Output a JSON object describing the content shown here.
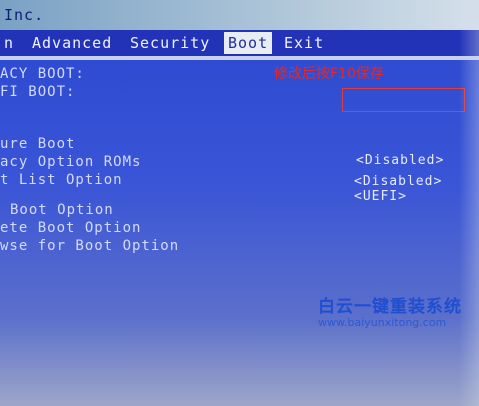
{
  "header": {
    "vendor": "Inc."
  },
  "menu": {
    "tabs": [
      {
        "label": "n"
      },
      {
        "label": "Advanced"
      },
      {
        "label": "Security"
      },
      {
        "label": "Boot"
      },
      {
        "label": "Exit"
      }
    ],
    "active_tab": "Boot"
  },
  "settings": {
    "items": [
      {
        "label": "ACY BOOT:"
      },
      {
        "label": "FI BOOT:"
      },
      {
        "label": "ure Boot"
      },
      {
        "label": "acy Option ROMs"
      },
      {
        "label": "t List Option"
      },
      {
        "label": "Boot Option"
      },
      {
        "label": "ete Boot Option"
      },
      {
        "label": "wse for Boot Option"
      }
    ],
    "values": [
      {
        "text": "<Disabled>"
      },
      {
        "text": "<Disabled>"
      },
      {
        "text": "<UEFI>"
      }
    ]
  },
  "annotation": {
    "note": "修改后按F10保存",
    "highlight_color": "#e23b3b"
  },
  "watermark": {
    "title": "白云一键重装系统",
    "url": "www.baiyunxitong.com"
  }
}
